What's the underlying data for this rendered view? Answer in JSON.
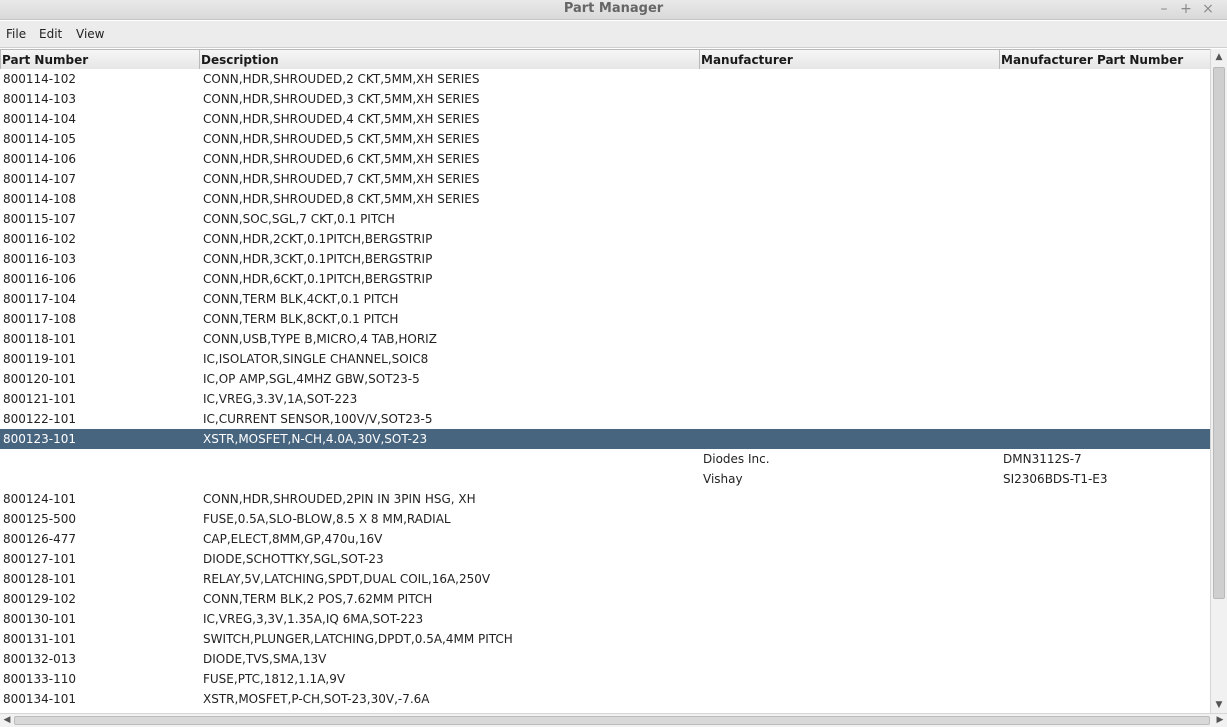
{
  "window": {
    "title": "Part Manager",
    "minimize": "–",
    "maximize": "+",
    "close": "×"
  },
  "menu": {
    "file": "File",
    "edit": "Edit",
    "view": "View"
  },
  "table": {
    "columns": [
      "Part Number",
      "Description",
      "Manufacturer",
      "Manufacturer Part Number"
    ],
    "rows": [
      {
        "part": "800114-102",
        "desc": "CONN,HDR,SHROUDED,2 CKT,5MM,XH SERIES",
        "mfr": "",
        "mpn": ""
      },
      {
        "part": "800114-103",
        "desc": "CONN,HDR,SHROUDED,3 CKT,5MM,XH SERIES",
        "mfr": "",
        "mpn": ""
      },
      {
        "part": "800114-104",
        "desc": "CONN,HDR,SHROUDED,4 CKT,5MM,XH SERIES",
        "mfr": "",
        "mpn": ""
      },
      {
        "part": "800114-105",
        "desc": "CONN,HDR,SHROUDED,5 CKT,5MM,XH SERIES",
        "mfr": "",
        "mpn": ""
      },
      {
        "part": "800114-106",
        "desc": "CONN,HDR,SHROUDED,6 CKT,5MM,XH SERIES",
        "mfr": "",
        "mpn": ""
      },
      {
        "part": "800114-107",
        "desc": "CONN,HDR,SHROUDED,7 CKT,5MM,XH SERIES",
        "mfr": "",
        "mpn": ""
      },
      {
        "part": "800114-108",
        "desc": "CONN,HDR,SHROUDED,8 CKT,5MM,XH SERIES",
        "mfr": "",
        "mpn": ""
      },
      {
        "part": "800115-107",
        "desc": "CONN,SOC,SGL,7 CKT,0.1 PITCH",
        "mfr": "",
        "mpn": ""
      },
      {
        "part": "800116-102",
        "desc": "CONN,HDR,2CKT,0.1PITCH,BERGSTRIP",
        "mfr": "",
        "mpn": ""
      },
      {
        "part": "800116-103",
        "desc": "CONN,HDR,3CKT,0.1PITCH,BERGSTRIP",
        "mfr": "",
        "mpn": ""
      },
      {
        "part": "800116-106",
        "desc": "CONN,HDR,6CKT,0.1PITCH,BERGSTRIP",
        "mfr": "",
        "mpn": ""
      },
      {
        "part": "800117-104",
        "desc": "CONN,TERM BLK,4CKT,0.1 PITCH",
        "mfr": "",
        "mpn": ""
      },
      {
        "part": "800117-108",
        "desc": "CONN,TERM BLK,8CKT,0.1 PITCH",
        "mfr": "",
        "mpn": ""
      },
      {
        "part": "800118-101",
        "desc": "CONN,USB,TYPE B,MICRO,4 TAB,HORIZ",
        "mfr": "",
        "mpn": ""
      },
      {
        "part": "800119-101",
        "desc": "IC,ISOLATOR,SINGLE CHANNEL,SOIC8",
        "mfr": "",
        "mpn": ""
      },
      {
        "part": "800120-101",
        "desc": "IC,OP AMP,SGL,4MHZ GBW,SOT23-5",
        "mfr": "",
        "mpn": ""
      },
      {
        "part": "800121-101",
        "desc": "IC,VREG,3.3V,1A,SOT-223",
        "mfr": "",
        "mpn": ""
      },
      {
        "part": "800122-101",
        "desc": "IC,CURRENT SENSOR,100V/V,SOT23-5",
        "mfr": "",
        "mpn": ""
      },
      {
        "part": "800123-101",
        "desc": "XSTR,MOSFET,N-CH,4.0A,30V,SOT-23",
        "mfr": "",
        "mpn": "",
        "selected": true
      },
      {
        "part": "",
        "desc": "",
        "mfr": "Diodes Inc.",
        "mpn": "DMN3112S-7"
      },
      {
        "part": "",
        "desc": "",
        "mfr": "Vishay",
        "mpn": "SI2306BDS-T1-E3"
      },
      {
        "part": "800124-101",
        "desc": "CONN,HDR,SHROUDED,2PIN IN 3PIN HSG, XH",
        "mfr": "",
        "mpn": ""
      },
      {
        "part": "800125-500",
        "desc": "FUSE,0.5A,SLO-BLOW,8.5 X 8 MM,RADIAL",
        "mfr": "",
        "mpn": ""
      },
      {
        "part": "800126-477",
        "desc": "CAP,ELECT,8MM,GP,470u,16V",
        "mfr": "",
        "mpn": ""
      },
      {
        "part": "800127-101",
        "desc": "DIODE,SCHOTTKY,SGL,SOT-23",
        "mfr": "",
        "mpn": ""
      },
      {
        "part": "800128-101",
        "desc": "RELAY,5V,LATCHING,SPDT,DUAL COIL,16A,250V",
        "mfr": "",
        "mpn": ""
      },
      {
        "part": "800129-102",
        "desc": "CONN,TERM BLK,2 POS,7.62MM PITCH",
        "mfr": "",
        "mpn": ""
      },
      {
        "part": "800130-101",
        "desc": "IC,VREG,3,3V,1.35A,IQ 6MA,SOT-223",
        "mfr": "",
        "mpn": ""
      },
      {
        "part": "800131-101",
        "desc": "SWITCH,PLUNGER,LATCHING,DPDT,0.5A,4MM PITCH",
        "mfr": "",
        "mpn": ""
      },
      {
        "part": "800132-013",
        "desc": "DIODE,TVS,SMA,13V",
        "mfr": "",
        "mpn": ""
      },
      {
        "part": "800133-110",
        "desc": "FUSE,PTC,1812,1.1A,9V",
        "mfr": "",
        "mpn": ""
      },
      {
        "part": "800134-101",
        "desc": "XSTR,MOSFET,P-CH,SOT-23,30V,-7.6A",
        "mfr": "",
        "mpn": ""
      }
    ]
  },
  "colors": {
    "selection": "#486580"
  }
}
